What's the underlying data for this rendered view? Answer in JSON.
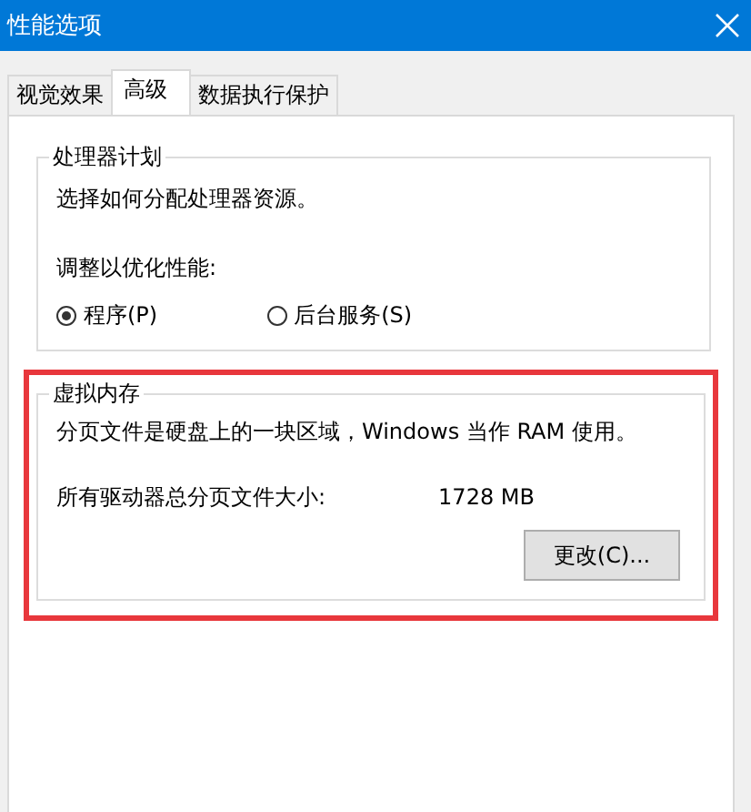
{
  "window": {
    "title": "性能选项"
  },
  "tabs": [
    {
      "label": "视觉效果",
      "selected": false
    },
    {
      "label": "高级",
      "selected": true
    },
    {
      "label": "数据执行保护",
      "selected": false
    }
  ],
  "processor_scheduling": {
    "title": "处理器计划",
    "description": "选择如何分配处理器资源。",
    "adjust_label": "调整以优化性能:",
    "options": [
      {
        "label": "程序(P)",
        "selected": true
      },
      {
        "label": "后台服务(S)",
        "selected": false
      }
    ]
  },
  "virtual_memory": {
    "title": "虚拟内存",
    "highlighted": true,
    "description": "分页文件是硬盘上的一块区域，Windows 当作 RAM 使用。",
    "total_label": "所有驱动器总分页文件大小:",
    "total_value": "1728 MB",
    "button": "更改(C)..."
  }
}
